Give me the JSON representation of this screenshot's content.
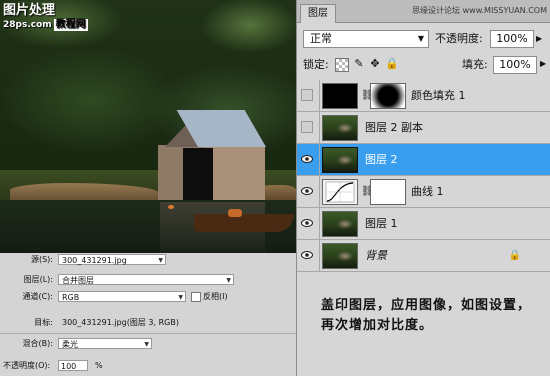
{
  "watermark": {
    "title": "图片处理",
    "site": "28ps.com",
    "tag": "教程网"
  },
  "apply_image": {
    "source_label": "源(S):",
    "source_value": "300_431291.jpg",
    "layer_label": "图层(L):",
    "layer_value": "合并图层",
    "channel_label": "通道(C):",
    "channel_value": "RGB",
    "invert_label": "反相(I)",
    "target_label": "目标:",
    "target_value": "300_431291.jpg(图层 3, RGB)",
    "blend_label": "混合(B):",
    "blend_value": "柔光",
    "opacity_label": "不透明度(O):",
    "opacity_value": "100",
    "opacity_unit": "%"
  },
  "panel": {
    "tab": "图层",
    "tab_watermark": "思缘设计论坛  www.MISSYUAN.COM",
    "blend_mode": "正常",
    "opacity_label": "不透明度:",
    "opacity_value": "100%",
    "lock_label": "锁定:",
    "fill_label": "填充:",
    "fill_value": "100%",
    "layers": [
      {
        "name": "颜色填充 1",
        "visible": false
      },
      {
        "name": "图层 2 副本",
        "visible": false
      },
      {
        "name": "图层 2",
        "visible": true,
        "selected": true
      },
      {
        "name": "曲线 1",
        "visible": true
      },
      {
        "name": "图层 1",
        "visible": true
      },
      {
        "name": "背景",
        "visible": true,
        "locked": true
      }
    ],
    "instruction": "盖印图层，应用图像，如图设置，再次增加对比度。"
  },
  "icons": {
    "eye": "eye-icon",
    "chain": "link-icon",
    "lock": "lock-icon",
    "lock_transparent": "checkerboard-icon",
    "lock_paint": "brush-icon",
    "lock_move": "move-icon"
  },
  "colors": {
    "selection": "#3a9eef",
    "panel_bg": "#d6d6d6"
  }
}
